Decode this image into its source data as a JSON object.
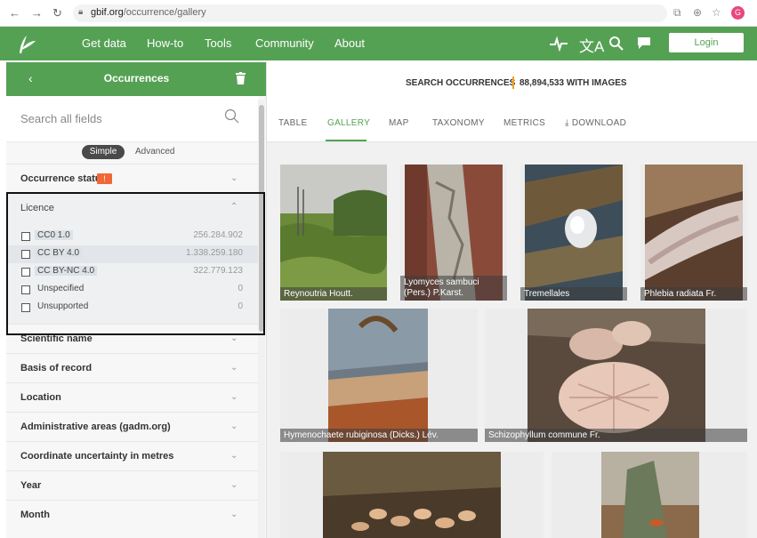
{
  "browser": {
    "url_host": "gbif.org",
    "url_path": "/occurrence/gallery",
    "profile_initial": "G"
  },
  "header": {
    "nav": [
      "Get data",
      "How-to",
      "Tools",
      "Community",
      "About"
    ],
    "login_label": "Login",
    "icons": [
      "pulse-icon",
      "translate-icon",
      "search-icon",
      "feedback-icon"
    ],
    "brand_color": "#55a154"
  },
  "sidebar": {
    "title": "Occurrences",
    "search_placeholder": "Search all fields",
    "mode_simple": "Simple",
    "mode_advanced": "Advanced",
    "facet_occurrence_status": "Occurrence status",
    "warning_badge": "!",
    "facet_licence": "Licence",
    "licences": [
      {
        "label": "CC0 1.0",
        "count": "256.284.902",
        "share": 0.192
      },
      {
        "label": "CC BY 4.0",
        "count": "1.338.259.180",
        "share": 1.0
      },
      {
        "label": "CC BY-NC 4.0",
        "count": "322.779.123",
        "share": 0.241
      },
      {
        "label": "Unspecified",
        "count": "0",
        "share": 0
      },
      {
        "label": "Unsupported",
        "count": "0",
        "share": 0
      }
    ],
    "facets_below": [
      "Scientific name",
      "Basis of record",
      "Location",
      "Administrative areas (gadm.org)",
      "Coordinate uncertainty in metres",
      "Year",
      "Month"
    ]
  },
  "main": {
    "search_label": "SEARCH OCCURRENCES",
    "image_count": "88,894,533 WITH IMAGES",
    "tabs": [
      "TABLE",
      "GALLERY",
      "MAP",
      "TAXONOMY",
      "METRICS",
      "DOWNLOAD"
    ],
    "active_tab": "GALLERY",
    "captions": [
      "Reynoutria Houtt.",
      "Lyomyces sambuci (Pers.) P.Karst.",
      "Tremellales",
      "Phlebia radiata Fr.",
      "Hymenochaete rubiginosa (Dicks.) Lév.",
      "Schizophyllum commune Fr."
    ]
  }
}
